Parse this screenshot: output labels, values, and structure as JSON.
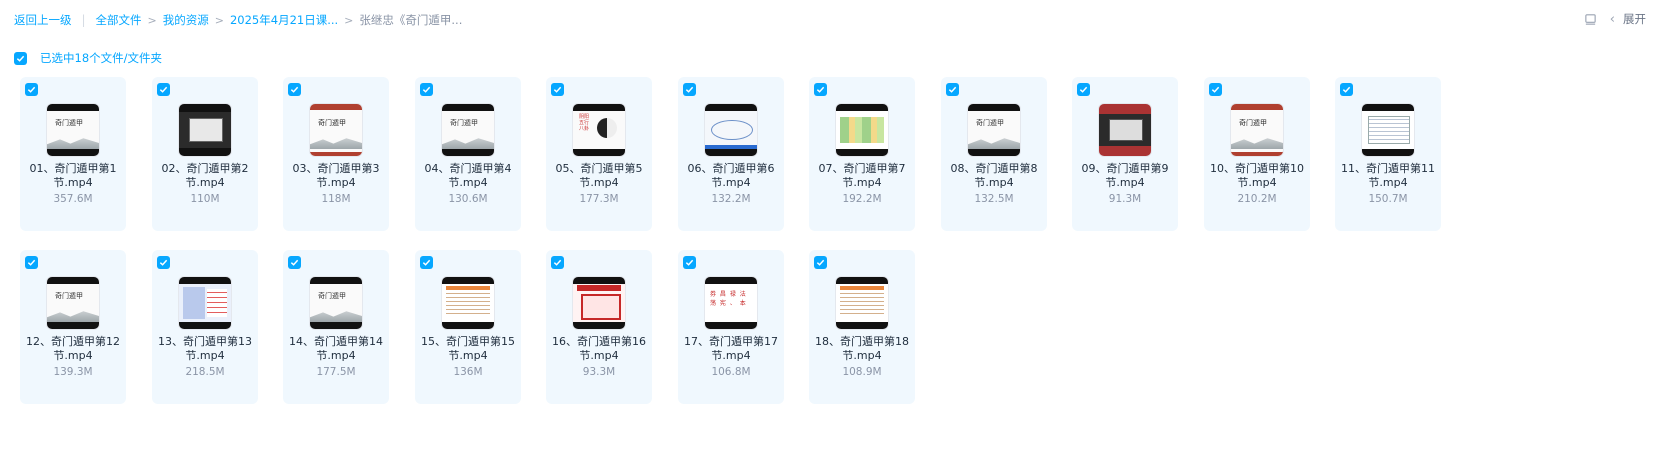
{
  "breadcrumb": {
    "back": "返回上一级",
    "items": [
      "全部文件",
      "我的资源",
      "2025年4月21日课...",
      "张继忠《奇门遁甲..."
    ]
  },
  "toolbar": {
    "expand_label": "展开"
  },
  "selection": {
    "label": "已选中18个文件/文件夹",
    "checked": true
  },
  "colors": {
    "accent": "#06a7ff",
    "card_bg": "#f0f8fe"
  },
  "files": [
    {
      "name": "01、奇门遁甲第1节.mp4",
      "size": "357.6M",
      "thumb": "ink-title"
    },
    {
      "name": "02、奇门遁甲第2节.mp4",
      "size": "110M",
      "thumb": "screen"
    },
    {
      "name": "03、奇门遁甲第3节.mp4",
      "size": "118M",
      "thumb": "ink-red"
    },
    {
      "name": "04、奇门遁甲第4节.mp4",
      "size": "130.6M",
      "thumb": "ink-title"
    },
    {
      "name": "05、奇门遁甲第5节.mp4",
      "size": "177.3M",
      "thumb": "taiji"
    },
    {
      "name": "06、奇门遁甲第6节.mp4",
      "size": "132.2M",
      "thumb": "diagram-blue"
    },
    {
      "name": "07、奇门遁甲第7节.mp4",
      "size": "192.2M",
      "thumb": "grid-green"
    },
    {
      "name": "08、奇门遁甲第8节.mp4",
      "size": "132.5M",
      "thumb": "ink-title"
    },
    {
      "name": "09、奇门遁甲第9节.mp4",
      "size": "91.3M",
      "thumb": "screen-red"
    },
    {
      "name": "10、奇门遁甲第10节.mp4",
      "size": "210.2M",
      "thumb": "ink-red"
    },
    {
      "name": "11、奇门遁甲第11节.mp4",
      "size": "150.7M",
      "thumb": "table"
    },
    {
      "name": "12、奇门遁甲第12节.mp4",
      "size": "139.3M",
      "thumb": "ink-title"
    },
    {
      "name": "13、奇门遁甲第13节.mp4",
      "size": "218.5M",
      "thumb": "list-blue"
    },
    {
      "name": "14、奇门遁甲第14节.mp4",
      "size": "177.5M",
      "thumb": "ink-title"
    },
    {
      "name": "15、奇门遁甲第15节.mp4",
      "size": "136M",
      "thumb": "table-orange"
    },
    {
      "name": "16、奇门遁甲第16节.mp4",
      "size": "93.3M",
      "thumb": "red-chart"
    },
    {
      "name": "17、奇门遁甲第17节.mp4",
      "size": "106.8M",
      "thumb": "red-text"
    },
    {
      "name": "18、奇门遁甲第18节.mp4",
      "size": "108.9M",
      "thumb": "table-orange"
    }
  ]
}
